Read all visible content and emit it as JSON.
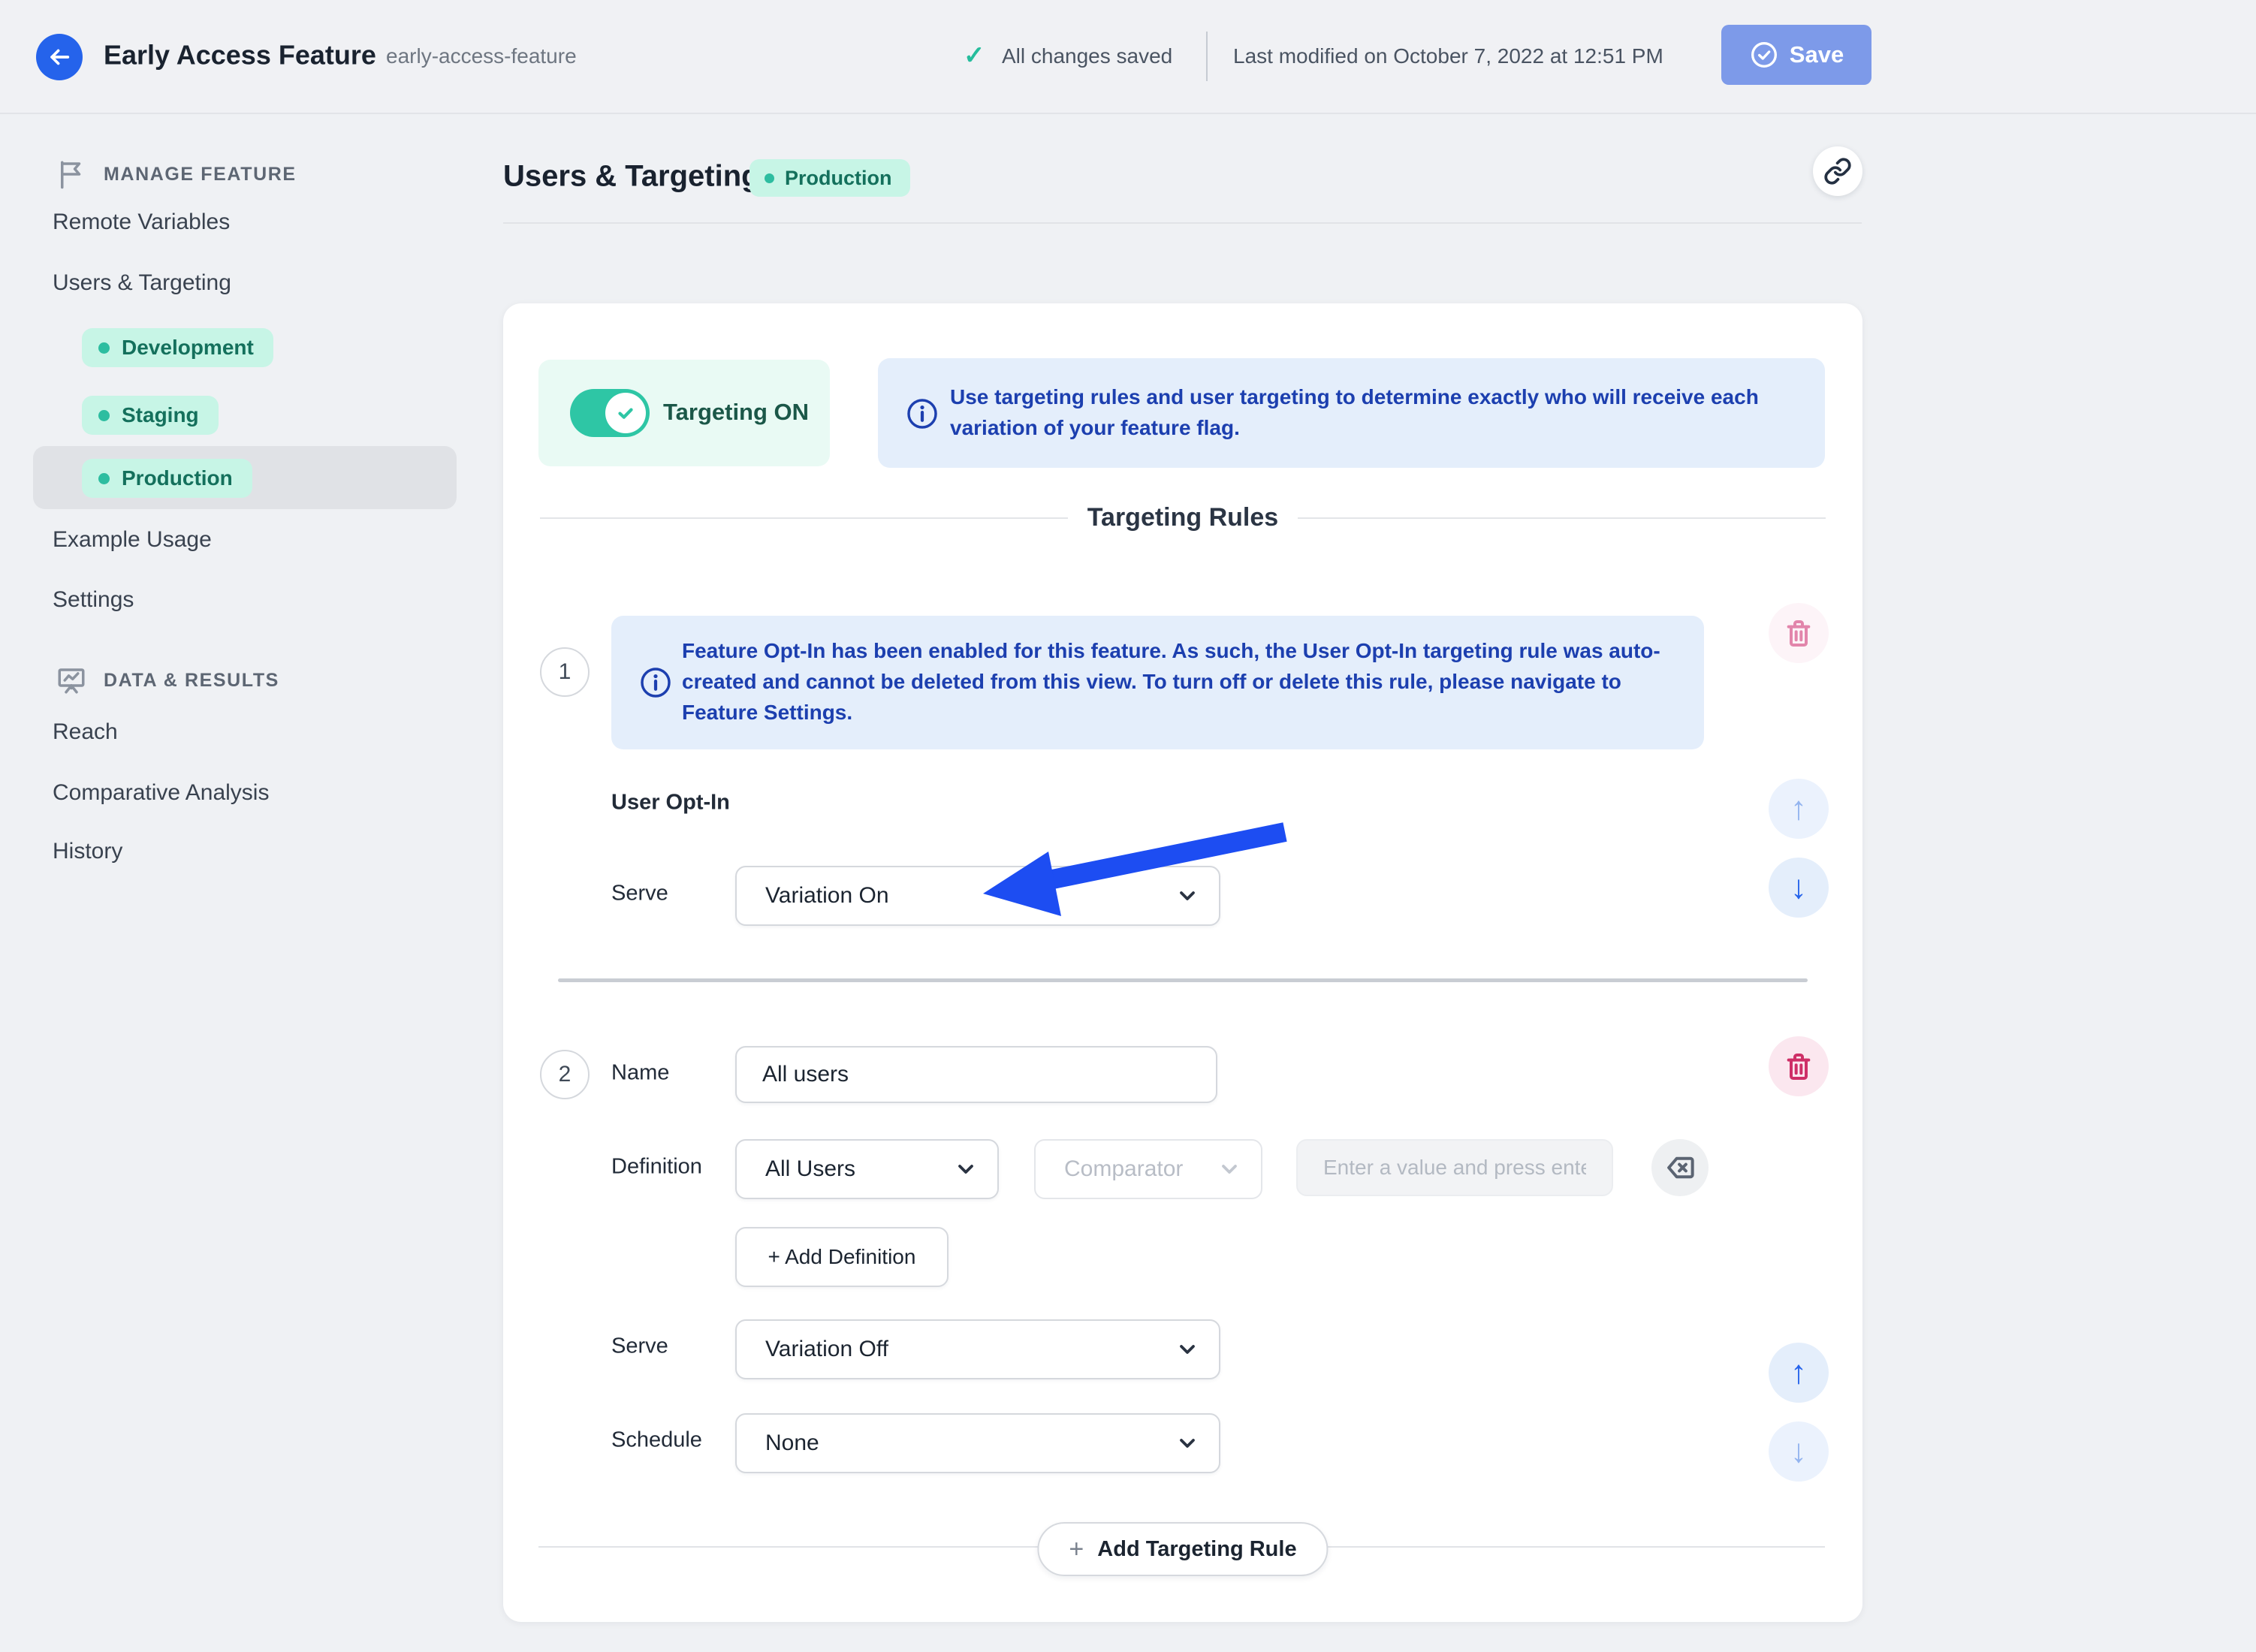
{
  "header": {
    "title": "Early Access Feature",
    "slug": "early-access-feature",
    "check_icon": "✓",
    "saved_status": "All changes saved",
    "last_modified": "Last modified on October 7, 2022 at 12:51 PM",
    "save_label": "Save"
  },
  "sidebar": {
    "manage_section": "MANAGE FEATURE",
    "remote_variables": "Remote Variables",
    "users_targeting": "Users & Targeting",
    "env_development": "Development",
    "env_staging": "Staging",
    "env_production": "Production",
    "example_usage": "Example Usage",
    "settings": "Settings",
    "data_section": "DATA & RESULTS",
    "reach": "Reach",
    "comparative_analysis": "Comparative Analysis",
    "history": "History"
  },
  "page": {
    "title": "Users & Targeting",
    "environment_badge": "Production"
  },
  "targeting": {
    "toggle_label": "Targeting ON",
    "info": "Use targeting rules and user targeting to determine exactly who will receive each variation of your feature flag.",
    "rules_heading": "Targeting Rules"
  },
  "rule1": {
    "number": "1",
    "info": "Feature Opt-In has been enabled for this feature. As such, the User Opt-In targeting rule was auto-created and cannot be deleted from this view. To turn off or delete this rule, please navigate to Feature Settings.",
    "name": "User Opt-In",
    "serve_label": "Serve",
    "serve_value": "Variation On"
  },
  "rule2": {
    "number": "2",
    "name_label": "Name",
    "name_value": "All users",
    "definition_label": "Definition",
    "definition_value": "All Users",
    "comparator_placeholder": "Comparator",
    "value_placeholder": "Enter a value and press enter...",
    "add_definition_label": "+ Add Definition",
    "serve_label": "Serve",
    "serve_value": "Variation Off",
    "schedule_label": "Schedule",
    "schedule_value": "None"
  },
  "actions": {
    "add_targeting_rule": "Add Targeting Rule"
  },
  "colors": {
    "accent_blue": "#2563eb",
    "toggle_teal": "#2ec6a5",
    "badge_bg": "#c7f5e6",
    "badge_text": "#14705c",
    "info_bg": "#e4eefb",
    "info_text": "#1c3faf",
    "danger": "#ce2f67",
    "danger_disabled": "#e285ab",
    "save_bg": "#7d9ae9",
    "annotation_arrow": "#1d4df2"
  }
}
